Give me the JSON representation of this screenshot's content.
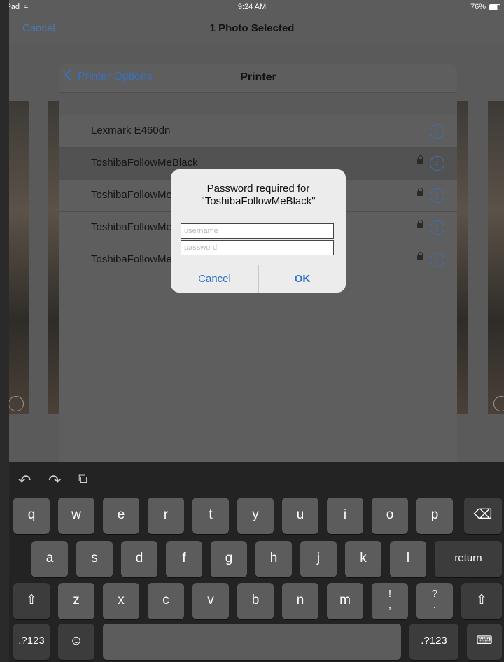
{
  "status_bar": {
    "device": "iPad",
    "wifi_icon": "wifi-icon",
    "time": "9:24 AM",
    "battery": "76%"
  },
  "top_nav": {
    "cancel": "Cancel",
    "title": "1 Photo Selected"
  },
  "printer_sheet": {
    "back_label": "Printer Options",
    "title": "Printer",
    "printers": [
      {
        "name": "Lexmark E460dn",
        "locked": false
      },
      {
        "name": "ToshibaFollowMeBlack",
        "locked": true
      },
      {
        "name": "ToshibaFollowMeBlack",
        "locked": true
      },
      {
        "name": "ToshibaFollowMe",
        "locked": true
      },
      {
        "name": "ToshibaFollowMe",
        "locked": true
      }
    ]
  },
  "dialog": {
    "message_line1": "Password required for",
    "message_line2": "\"ToshibaFollowMeBlack\"",
    "username_placeholder": "username",
    "password_placeholder": "password",
    "cancel": "Cancel",
    "ok": "OK"
  },
  "keyboard": {
    "row1": [
      "q",
      "w",
      "e",
      "r",
      "t",
      "y",
      "u",
      "i",
      "o",
      "p"
    ],
    "row2": [
      "a",
      "s",
      "d",
      "f",
      "g",
      "h",
      "j",
      "k",
      "l"
    ],
    "row3": [
      "z",
      "x",
      "c",
      "v",
      "b",
      "n",
      "m",
      "!\n,",
      "?\n."
    ],
    "return": "return",
    "numbers": ".?123",
    "numbers_right": ".?123",
    "icons": {
      "undo": "undo-icon",
      "redo": "redo-icon",
      "paste": "paste-icon",
      "delete": "backspace-icon",
      "shift": "shift-icon",
      "emoji": "emoji-icon",
      "hide": "keyboard-hide-icon"
    }
  },
  "colors": {
    "accent": "#3b71b8",
    "dialog_accent": "#2f6fcc"
  }
}
